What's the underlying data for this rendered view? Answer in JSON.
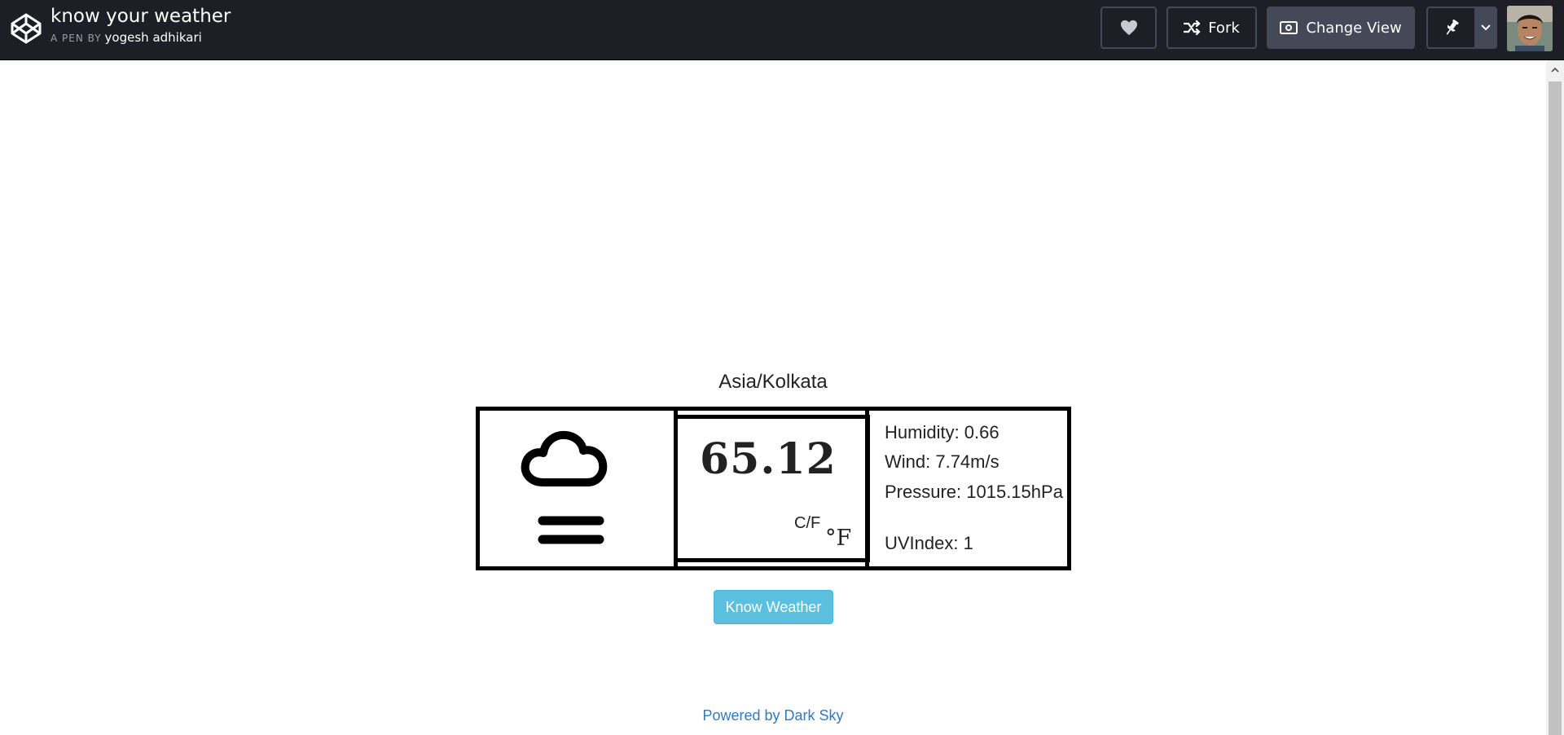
{
  "header": {
    "pen_title": "know your weather",
    "by_label": "A PEN BY",
    "author": "yogesh adhikari",
    "buttons": {
      "heart_icon": "heart-icon",
      "fork_label": "Fork",
      "change_view_label": "Change View",
      "pin_icon": "pin-icon",
      "caret_icon": "chevron-down-icon"
    }
  },
  "weather": {
    "location": "Asia/Kolkata",
    "icon": "fog-icon",
    "temperature": "65.12",
    "unit_toggle": "C/F",
    "unit_symbol": "°F",
    "humidity": "Humidity: 0.66",
    "wind": "Wind: 7.74m/s",
    "pressure": "Pressure: 1015.15hPa",
    "uv_index": "UVIndex: 1"
  },
  "actions": {
    "know_weather_label": "Know Weather"
  },
  "footer": {
    "powered_prefix": "Powered by ",
    "powered_link": "Dark Sky"
  },
  "colors": {
    "topbar_bg": "#1e1f26",
    "button_accent": "#5bc0de",
    "link": "#337ab7"
  }
}
